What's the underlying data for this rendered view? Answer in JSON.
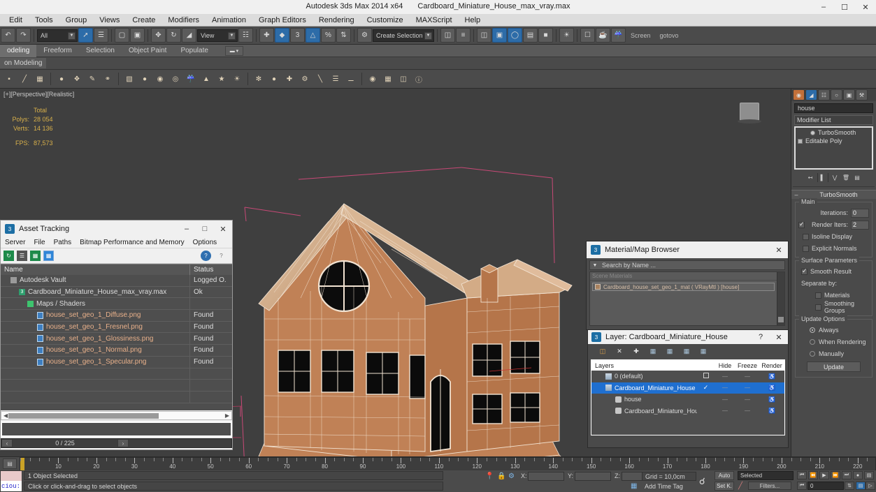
{
  "titlebar": {
    "app": "Autodesk 3ds Max  2014 x64",
    "file": "Cardboard_Miniature_House_max_vray.max",
    "minimize": "–",
    "maximize": "☐",
    "close": "✕"
  },
  "menubar": {
    "items": [
      "Edit",
      "Tools",
      "Group",
      "Views",
      "Create",
      "Modifiers",
      "Animation",
      "Graph Editors",
      "Rendering",
      "Customize",
      "MAXScript",
      "Help"
    ]
  },
  "maintoolbar": {
    "selection_filter": "All",
    "ref_coord_system": "View",
    "named_selection_sets": "Create Selection S",
    "snap_value": "3",
    "screen_label": "Screen",
    "status_label": "gotovo"
  },
  "ribbon": {
    "tabs": [
      "odeling",
      "Freeform",
      "Selection",
      "Object Paint",
      "Populate"
    ],
    "active_tab": "odeling",
    "subtab": "on Modeling"
  },
  "viewport": {
    "label": "[+][Perspective][Realistic]",
    "stats": {
      "header": "Total",
      "polys_label": "Polys:",
      "polys_value": "28 054",
      "verts_label": "Verts:",
      "verts_value": "14 136",
      "fps_label": "FPS:",
      "fps_value": "87,573"
    },
    "model_color": "#c08156",
    "wire_color": "#f2e3d2",
    "background": "#3f3f3f"
  },
  "command_panel": {
    "tabs": [
      "create-tab",
      "modify-tab",
      "hierarchy-tab",
      "motion-tab",
      "display-tab",
      "utilities-tab"
    ],
    "active_tab_index": 1,
    "object_name": "house",
    "modifier_list_label": "Modifier List",
    "stack": [
      {
        "label": "TurboSmooth",
        "icon": "dot"
      },
      {
        "label": "Editable Poly",
        "icon": "square"
      }
    ],
    "rollout": {
      "title": "TurboSmooth",
      "collapse_glyph": "–",
      "main_group": "Main",
      "iterations_label": "Iterations:",
      "iterations_value": "0",
      "render_iters_label": "Render Iters:",
      "render_iters_value": "2",
      "render_iters_checked": true,
      "isoline_display": "Isoline Display",
      "isoline_checked": false,
      "explicit_normals": "Explicit Normals",
      "explicit_checked": false,
      "surface_group": "Surface Parameters",
      "smooth_result": "Smooth Result",
      "smooth_result_checked": true,
      "separate_by": "Separate by:",
      "materials": "Materials",
      "materials_checked": false,
      "smoothing_groups": "Smoothing Groups",
      "smoothing_groups_checked": false,
      "update_group": "Update Options",
      "update_always": "Always",
      "update_when_rendering": "When Rendering",
      "update_manually": "Manually",
      "update_selected": "Always",
      "update_button": "Update"
    }
  },
  "asset_tracking": {
    "title": "Asset Tracking",
    "menu": [
      "Server",
      "File",
      "Paths",
      "Bitmap Performance and Memory",
      "Options"
    ],
    "columns": [
      "Name",
      "Status"
    ],
    "rows": [
      {
        "name": "Autodesk Vault",
        "status": "Logged O.",
        "indent": 1,
        "icon": "vault-icon",
        "filename": false
      },
      {
        "name": "Cardboard_Miniature_House_max_vray.max",
        "status": "Ok",
        "indent": 2,
        "icon": "max-file-icon",
        "filename": false
      },
      {
        "name": "Maps / Shaders",
        "status": "",
        "indent": 3,
        "icon": "maps-icon",
        "filename": false
      },
      {
        "name": "house_set_geo_1_Diffuse.png",
        "status": "Found",
        "indent": 4,
        "icon": "bitmap-icon",
        "filename": true
      },
      {
        "name": "house_set_geo_1_Fresnel.png",
        "status": "Found",
        "indent": 4,
        "icon": "bitmap-icon",
        "filename": true
      },
      {
        "name": "house_set_geo_1_Glossiness.png",
        "status": "Found",
        "indent": 4,
        "icon": "bitmap-icon",
        "filename": true
      },
      {
        "name": "house_set_geo_1_Normal.png",
        "status": "Found",
        "indent": 4,
        "icon": "bitmap-icon",
        "filename": true
      },
      {
        "name": "house_set_geo_1_Specular.png",
        "status": "Found",
        "indent": 4,
        "icon": "bitmap-icon",
        "filename": true
      }
    ],
    "frame_indicator": "0 / 225",
    "prev_glyph": "‹",
    "next_glyph": "›"
  },
  "material_browser": {
    "title": "Material/Map Browser",
    "search_placeholder": "Search by Name ...",
    "group_label": "Scene Materials",
    "items": [
      {
        "label": "Cardboard_house_set_geo_1_mat ( VRayMtl ) [house]"
      }
    ]
  },
  "layer_dialog": {
    "title": "Layer: Cardboard_Miniature_House",
    "help_glyph": "?",
    "close_glyph": "✕",
    "columns": [
      "Layers",
      "Hide",
      "Freeze",
      "Render"
    ],
    "rows": [
      {
        "name": "0 (default)",
        "indent": 1,
        "type": "layer",
        "selected": false,
        "current": false,
        "hide": "",
        "freeze": "",
        "render": "on"
      },
      {
        "name": "Cardboard_Miniature_House",
        "indent": 1,
        "type": "layer",
        "selected": true,
        "current": true,
        "hide": "",
        "freeze": "",
        "render": "on"
      },
      {
        "name": "house",
        "indent": 2,
        "type": "object",
        "selected": false,
        "current": false,
        "hide": "",
        "freeze": "",
        "render": "on"
      },
      {
        "name": "Cardboard_Miniature_House",
        "indent": 2,
        "type": "object",
        "selected": false,
        "current": false,
        "hide": "",
        "freeze": "",
        "render": "on"
      }
    ]
  },
  "timeline": {
    "ticks": [
      10,
      20,
      30,
      40,
      50,
      60,
      70,
      80,
      90,
      100,
      110,
      120,
      130,
      140,
      150,
      160,
      170,
      180,
      190,
      200,
      210,
      220
    ],
    "range_max": 225,
    "current_frame": 0
  },
  "statusbar": {
    "selection_status": "1 Object Selected",
    "prompt": "Click or click-and-drag to select objects",
    "x_label": "X:",
    "x_value": "",
    "y_label": "Y:",
    "y_value": "",
    "z_label": "Z:",
    "z_value": "",
    "grid": "Grid = 10,0cm",
    "add_time_tag": "Add Time Tag",
    "auto_key": "Auto",
    "set_key": "Set K.",
    "key_filter": "Selected",
    "filters_button": "Filters...",
    "frame_value": "0"
  }
}
